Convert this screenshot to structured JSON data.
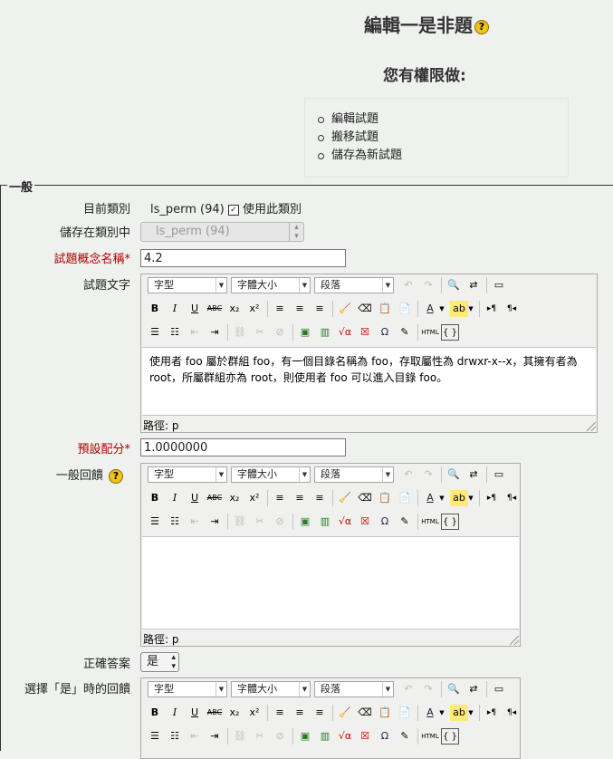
{
  "header": {
    "title": "編輯一是非題",
    "help_glyph": "?",
    "permissions_title": "您有權限做:",
    "permissions": [
      "編輯試題",
      "搬移試題",
      "儲存為新試題"
    ]
  },
  "form": {
    "legend": "一般",
    "current_category_label": "目前類別",
    "current_category_value": "ls_perm (94)",
    "use_category_label": "使用此類別",
    "use_category_checked": true,
    "save_in_category_label": "儲存在類別中",
    "save_in_category_value": "ls_perm (94)",
    "question_name_label": "試題概念名稱",
    "question_name_value": "4.2",
    "question_text_label": "試題文字",
    "question_text_content": "使用者 foo 屬於群組 foo，有一個目錄名稱為 foo，存取屬性為 drwxr-x--x，其擁有者為 root，所屬群組亦為 root，則使用者 foo 可以進入目錄 foo。",
    "default_grade_label": "預設配分",
    "default_grade_value": "1.0000000",
    "general_feedback_label": "一般回饋",
    "general_feedback_content": "",
    "correct_answer_label": "正確答案",
    "correct_answer_value": "是",
    "feedback_true_label": "選擇「是」時的回饋",
    "required_star": "*"
  },
  "editor": {
    "font_select": "字型",
    "size_select": "字體大小",
    "format_select": "段落",
    "path_label": "路徑: p",
    "bold_glyph": "B",
    "italic_glyph": "I",
    "underline_glyph": "U",
    "strike_glyph": "ABC",
    "sub_glyph": "x₂",
    "sup_glyph": "x²",
    "html_glyph": "HTML",
    "code_glyph": "{ }",
    "omega_glyph": "Ω",
    "textcolor_glyph": "A",
    "ltr_glyph": "▸¶",
    "rtl_glyph": "¶◂"
  }
}
